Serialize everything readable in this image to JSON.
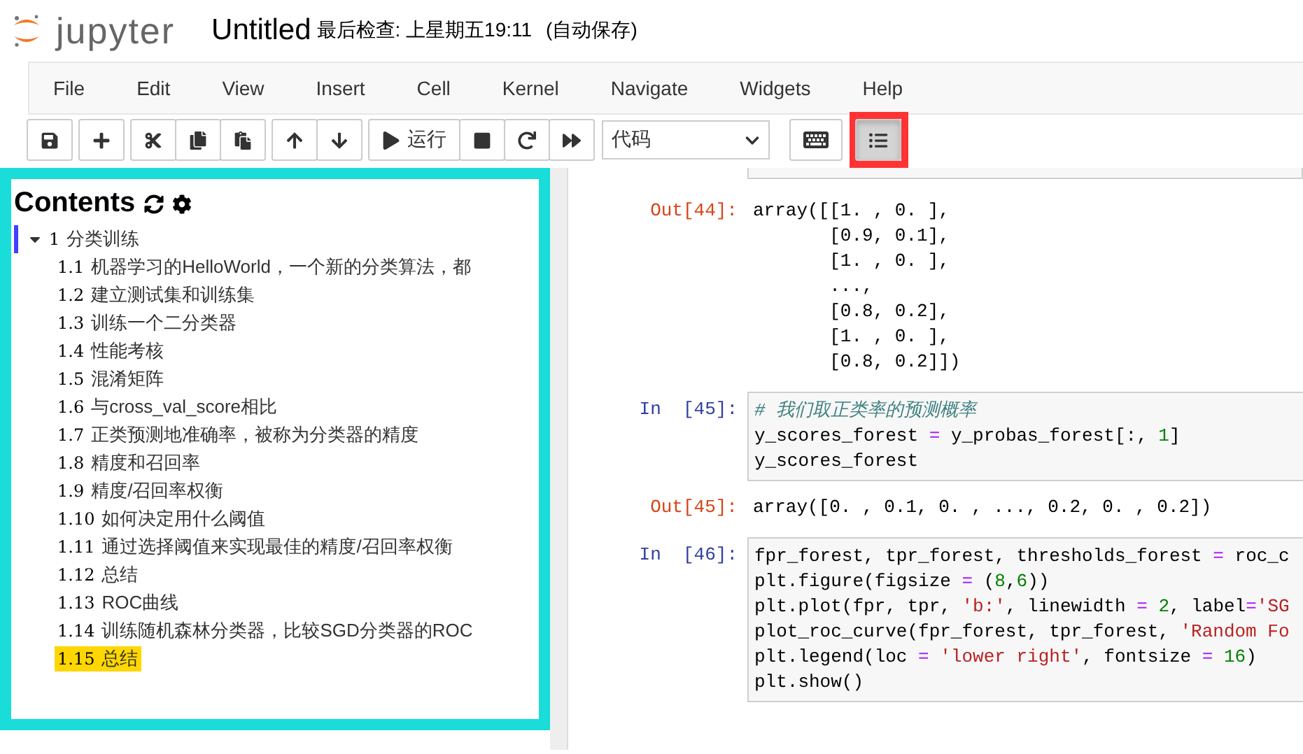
{
  "header": {
    "logo_text": "jupyter",
    "notebook_title": "Untitled",
    "checkpoint": "最后检查: 上星期五19:11",
    "autosave": "(自动保存)"
  },
  "menu": [
    "File",
    "Edit",
    "View",
    "Insert",
    "Cell",
    "Kernel",
    "Navigate",
    "Widgets",
    "Help"
  ],
  "toolbar": {
    "groups": [
      [
        {
          "kind": "save",
          "selected": false,
          "highlighted": false
        }
      ],
      [
        {
          "kind": "add",
          "selected": false,
          "highlighted": false
        }
      ],
      [
        {
          "kind": "cut",
          "selected": false,
          "highlighted": false
        },
        {
          "kind": "copy",
          "selected": false,
          "highlighted": false
        },
        {
          "kind": "paste",
          "selected": false,
          "highlighted": false
        }
      ],
      [
        {
          "kind": "up",
          "selected": false,
          "highlighted": false
        },
        {
          "kind": "down",
          "selected": false,
          "highlighted": false
        }
      ],
      [
        {
          "kind": "run",
          "label": "运行",
          "selected": false,
          "highlighted": false
        },
        {
          "kind": "stop",
          "selected": false,
          "highlighted": false
        },
        {
          "kind": "restart",
          "selected": false,
          "highlighted": false
        },
        {
          "kind": "fastforward",
          "selected": false,
          "highlighted": false
        }
      ]
    ],
    "cell_type": "代码",
    "extra": [
      {
        "kind": "keyboard",
        "selected": false,
        "highlighted": false
      },
      {
        "kind": "toc",
        "selected": true,
        "highlighted": true
      }
    ]
  },
  "toc": {
    "title": "Contents",
    "items": [
      {
        "number": "1",
        "label": "分类训练",
        "selected": false,
        "expanded": true,
        "children": [
          {
            "number": "1.1",
            "label": "机器学习的HelloWorld，一个新的分类算法，都",
            "selected": false
          },
          {
            "number": "1.2",
            "label": "建立测试集和训练集",
            "selected": false
          },
          {
            "number": "1.3",
            "label": "训练一个二分类器",
            "selected": false
          },
          {
            "number": "1.4",
            "label": "性能考核",
            "selected": false
          },
          {
            "number": "1.5",
            "label": "混淆矩阵",
            "selected": false
          },
          {
            "number": "1.6",
            "label": "与cross_val_score相比",
            "selected": false
          },
          {
            "number": "1.7",
            "label": "正类预测地准确率，被称为分类器的精度",
            "selected": false
          },
          {
            "number": "1.8",
            "label": "精度和召回率",
            "selected": false
          },
          {
            "number": "1.9",
            "label": "精度/召回率权衡",
            "selected": false
          },
          {
            "number": "1.10",
            "label": "如何决定用什么阈值",
            "selected": false
          },
          {
            "number": "1.11",
            "label": "通过选择阈值来实现最佳的精度/召回率权衡",
            "selected": false
          },
          {
            "number": "1.12",
            "label": "总结",
            "selected": false
          },
          {
            "number": "1.13",
            "label": "ROC曲线",
            "selected": false
          },
          {
            "number": "1.14",
            "label": "训练随机森林分类器，比较SGD分类器的ROC",
            "selected": false
          },
          {
            "number": "1.15",
            "label": "总结",
            "selected": true
          }
        ]
      }
    ]
  },
  "cells": [
    {
      "kind": "output",
      "prompt": "Out[44]:",
      "lines": [
        [
          {
            "kind": "plain",
            "text": "array([[1. , 0. ],"
          }
        ],
        [
          {
            "kind": "plain",
            "text": "       [0.9, 0.1],"
          }
        ],
        [
          {
            "kind": "plain",
            "text": "       [1. , 0. ],"
          }
        ],
        [
          {
            "kind": "plain",
            "text": "       ...,"
          }
        ],
        [
          {
            "kind": "plain",
            "text": "       [0.8, 0.2],"
          }
        ],
        [
          {
            "kind": "plain",
            "text": "       [1. , 0. ],"
          }
        ],
        [
          {
            "kind": "plain",
            "text": "       [0.8, 0.2]])"
          }
        ]
      ]
    },
    {
      "kind": "input",
      "prompt": "In  [45]:",
      "lines": [
        [
          {
            "kind": "comment",
            "text": "# 我们取正类率的预测概率"
          }
        ],
        [
          {
            "kind": "plain",
            "text": "y_scores_forest "
          },
          {
            "kind": "op",
            "text": "="
          },
          {
            "kind": "plain",
            "text": " y_probas_forest[:, "
          },
          {
            "kind": "num",
            "text": "1"
          },
          {
            "kind": "plain",
            "text": "]"
          }
        ],
        [
          {
            "kind": "plain",
            "text": "y_scores_forest"
          }
        ]
      ]
    },
    {
      "kind": "output",
      "prompt": "Out[45]:",
      "lines": [
        [
          {
            "kind": "plain",
            "text": "array([0. , 0.1, 0. , ..., 0.2, 0. , 0.2])"
          }
        ]
      ]
    },
    {
      "kind": "input",
      "prompt": "In  [46]:",
      "lines": [
        [
          {
            "kind": "plain",
            "text": "fpr_forest, tpr_forest, thresholds_forest "
          },
          {
            "kind": "op",
            "text": "="
          },
          {
            "kind": "plain",
            "text": " roc_c"
          }
        ],
        [
          {
            "kind": "plain",
            "text": "plt.figure(figsize "
          },
          {
            "kind": "op",
            "text": "="
          },
          {
            "kind": "plain",
            "text": " ("
          },
          {
            "kind": "num",
            "text": "8"
          },
          {
            "kind": "plain",
            "text": ","
          },
          {
            "kind": "num",
            "text": "6"
          },
          {
            "kind": "plain",
            "text": "))"
          }
        ],
        [
          {
            "kind": "plain",
            "text": "plt.plot(fpr, tpr, "
          },
          {
            "kind": "str",
            "text": "'b:'"
          },
          {
            "kind": "plain",
            "text": ", linewidth "
          },
          {
            "kind": "op",
            "text": "= "
          },
          {
            "kind": "num",
            "text": "2"
          },
          {
            "kind": "plain",
            "text": ", label"
          },
          {
            "kind": "op",
            "text": "="
          },
          {
            "kind": "str",
            "text": "'SG"
          }
        ],
        [
          {
            "kind": "plain",
            "text": "plot_roc_curve(fpr_forest, tpr_forest, "
          },
          {
            "kind": "str",
            "text": "'Random Fo"
          }
        ],
        [
          {
            "kind": "plain",
            "text": "plt.legend(loc "
          },
          {
            "kind": "op",
            "text": "= "
          },
          {
            "kind": "str",
            "text": "'lower right'"
          },
          {
            "kind": "plain",
            "text": ", fontsize "
          },
          {
            "kind": "op",
            "text": "= "
          },
          {
            "kind": "num",
            "text": "16"
          },
          {
            "kind": "plain",
            "text": ")"
          }
        ],
        [
          {
            "kind": "plain",
            "text": "plt.show()"
          }
        ]
      ]
    }
  ]
}
